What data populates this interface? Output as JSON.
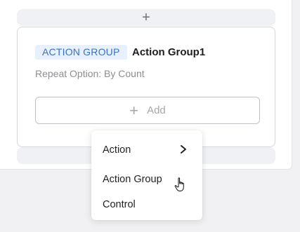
{
  "builder": {
    "insert_above_label": "+",
    "card": {
      "type_tag": "ACTION GROUP",
      "name": "Action Group1",
      "repeat_option": "Repeat Option: By Count",
      "add_button": {
        "icon": "plus-icon",
        "label": "Add"
      }
    }
  },
  "dropdown_menu": {
    "items": [
      {
        "label": "Action",
        "submenu_icon": "chevron-right-icon"
      },
      {
        "label": "Action Group"
      },
      {
        "label": "Control"
      }
    ]
  },
  "colors": {
    "tag_background": "#e7f0fb",
    "tag_text": "#3a72c5",
    "muted_text": "#8b8e93"
  },
  "cursor": "pointer-hand-icon"
}
